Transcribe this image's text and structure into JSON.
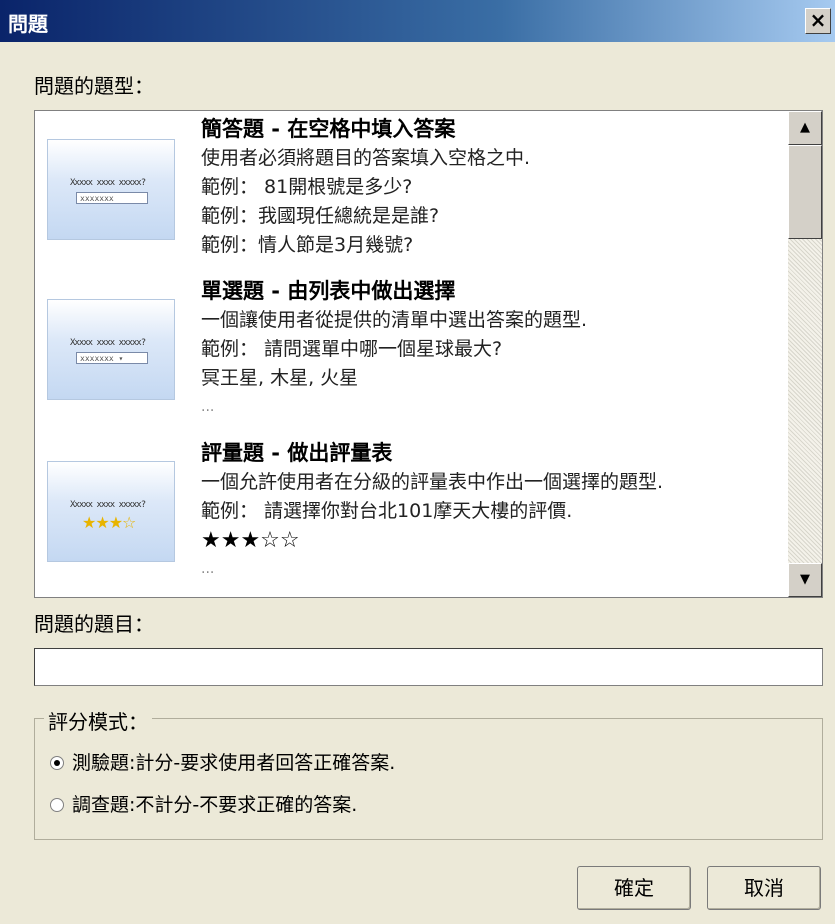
{
  "window": {
    "title": "問題",
    "close": "×"
  },
  "types_label": "問題的題型：",
  "question_types": [
    {
      "title": "簡答題 - 在空格中填入答案",
      "lines": [
        "使用者必須將題目的答案填入空格之中.",
        "範例： 81開根號是多少?",
        "範例：我國現任總統是是誰?",
        "範例：情人節是3月幾號?"
      ],
      "thumbnail": {
        "question": "Xxxxx xxxx xxxxx?",
        "control": "xxxxxxx",
        "icon": "textbox-icon"
      }
    },
    {
      "title": "單選題 - 由列表中做出選擇",
      "lines": [
        "一個讓使用者從提供的清單中選出答案的題型.",
        "範例： 請問選單中哪一個星球最大?",
        "冥王星, 木星, 火星",
        "..."
      ],
      "thumbnail": {
        "question": "Xxxxx xxxx xxxxx?",
        "control": "xxxxxxx ▾",
        "icon": "dropdown-icon"
      }
    },
    {
      "title": "評量題 - 做出評量表",
      "lines": [
        "一個允許使用者在分級的評量表中作出一個選擇的題型.",
        "範例： 請選擇你對台北101摩天大樓的評價.",
        "★★★☆☆",
        "..."
      ],
      "thumbnail": {
        "question": "Xxxxx xxxx xxxxx?",
        "control": "★★★☆",
        "icon": "stars-icon"
      }
    }
  ],
  "scrollbar": {
    "up": "▲",
    "down": "▼"
  },
  "question_label": "問題的題目：",
  "question_input": {
    "value": "",
    "placeholder": ""
  },
  "scoring": {
    "legend": "評分模式：",
    "options": [
      {
        "label": "測驗題:計分-要求使用者回答正確答案.",
        "selected": true
      },
      {
        "label": "調查題:不計分-不要求正確的答案.",
        "selected": false
      }
    ]
  },
  "buttons": {
    "ok": "確定",
    "cancel": "取消"
  }
}
